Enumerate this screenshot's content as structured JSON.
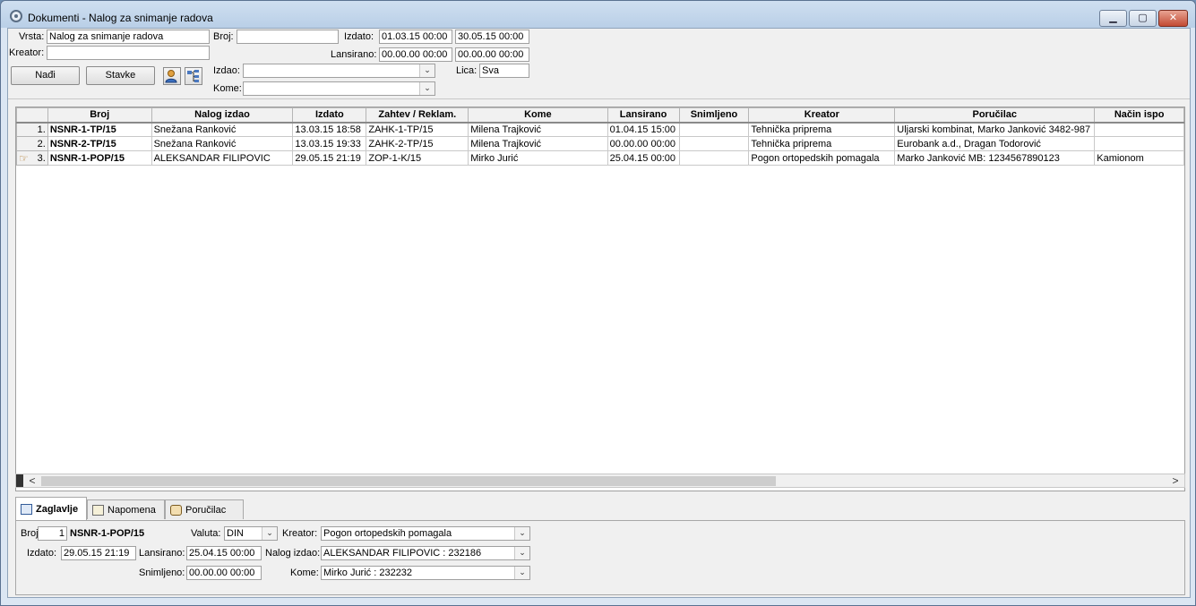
{
  "window": {
    "title": "Dokumenti - Nalog za snimanje radova",
    "min_glyph": "▁",
    "max_glyph": "▢",
    "close_glyph": "✕"
  },
  "filters": {
    "vrsta_label": "Vrsta:",
    "vrsta_value": "Nalog za snimanje radova",
    "broj_label": "Broj:",
    "broj_value": "",
    "izdato_label": "Izdato:",
    "izdato_from": "01.03.15 00:00",
    "izdato_to": "30.05.15 00:00",
    "kreator_label": "Kreator:",
    "kreator_value": "",
    "lansirano_label": "Lansirano:",
    "lansirano_from": "00.00.00 00:00",
    "lansirano_to": "00.00.00 00:00",
    "izdao_label": "Izdao:",
    "izdao_value": "",
    "kome_label": "Kome:",
    "kome_value": "",
    "lica_label": "Lica:",
    "lica_value": "Sva",
    "nadji_label": "Nađi",
    "stavke_label": "Stavke"
  },
  "grid": {
    "columns": [
      "Broj",
      "Nalog izdao",
      "Izdato",
      "Zahtev / Reklam.",
      "Kome",
      "Lansirano",
      "Snimljeno",
      "Kreator",
      "Poručilac",
      "Način ispo"
    ],
    "rows": [
      {
        "idx": "1.",
        "cells": [
          "NSNR-1-TP/15",
          "Snežana Ranković",
          "13.03.15 18:58",
          "ZAHK-1-TP/15",
          "Milena Trajković",
          "01.04.15 15:00",
          "",
          "Tehnička priprema",
          "Uljarski kombinat, Marko Janković 3482-987",
          ""
        ]
      },
      {
        "idx": "2.",
        "cells": [
          "NSNR-2-TP/15",
          "Snežana Ranković",
          "13.03.15 19:33",
          "ZAHK-2-TP/15",
          "Milena Trajković",
          "00.00.00 00:00",
          "",
          "Tehnička priprema",
          "Eurobank a.d., Dragan Todorović",
          ""
        ]
      },
      {
        "idx": "3.",
        "cells": [
          "NSNR-1-POP/15",
          "ALEKSANDAR FILIPOVIC",
          "29.05.15 21:19",
          "ZOP-1-K/15",
          "Mirko Jurić",
          "25.04.15 00:00",
          "",
          "Pogon ortopedskih pomagala",
          "Marko Janković MB: 1234567890123",
          "Kamionom"
        ]
      }
    ]
  },
  "scroll": {
    "left_arrow": "<",
    "right_arrow": ">"
  },
  "tabs": [
    {
      "label": "Zaglavlje",
      "icon": "document-lines-icon"
    },
    {
      "label": "Napomena",
      "icon": "note-pencil-icon"
    },
    {
      "label": "Poručilac",
      "icon": "handshake-icon"
    }
  ],
  "detail": {
    "broj_label": "Broj:",
    "broj_num": "1",
    "broj_doc": "NSNR-1-POP/15",
    "valuta_label": "Valuta:",
    "valuta_value": "DIN",
    "kreator_label": "Kreator:",
    "kreator_value": "Pogon ortopedskih pomagala",
    "izdato_label": "Izdato:",
    "izdato_value": "29.05.15 21:19",
    "lansirano_label": "Lansirano:",
    "lansirano_value": "25.04.15 00:00",
    "nalog_izdao_label": "Nalog izdao:",
    "nalog_izdao_value": "ALEKSANDAR FILIPOVIC : 232186",
    "snimljeno_label": "Snimljeno:",
    "snimljeno_value": "00.00.00 00:00",
    "kome_label": "Kome:",
    "kome_value": "Mirko Jurić : 232232"
  },
  "colors": {
    "accent": "#335c9a",
    "window_frame": "#5b7291"
  },
  "combo_glyph": "⌄"
}
